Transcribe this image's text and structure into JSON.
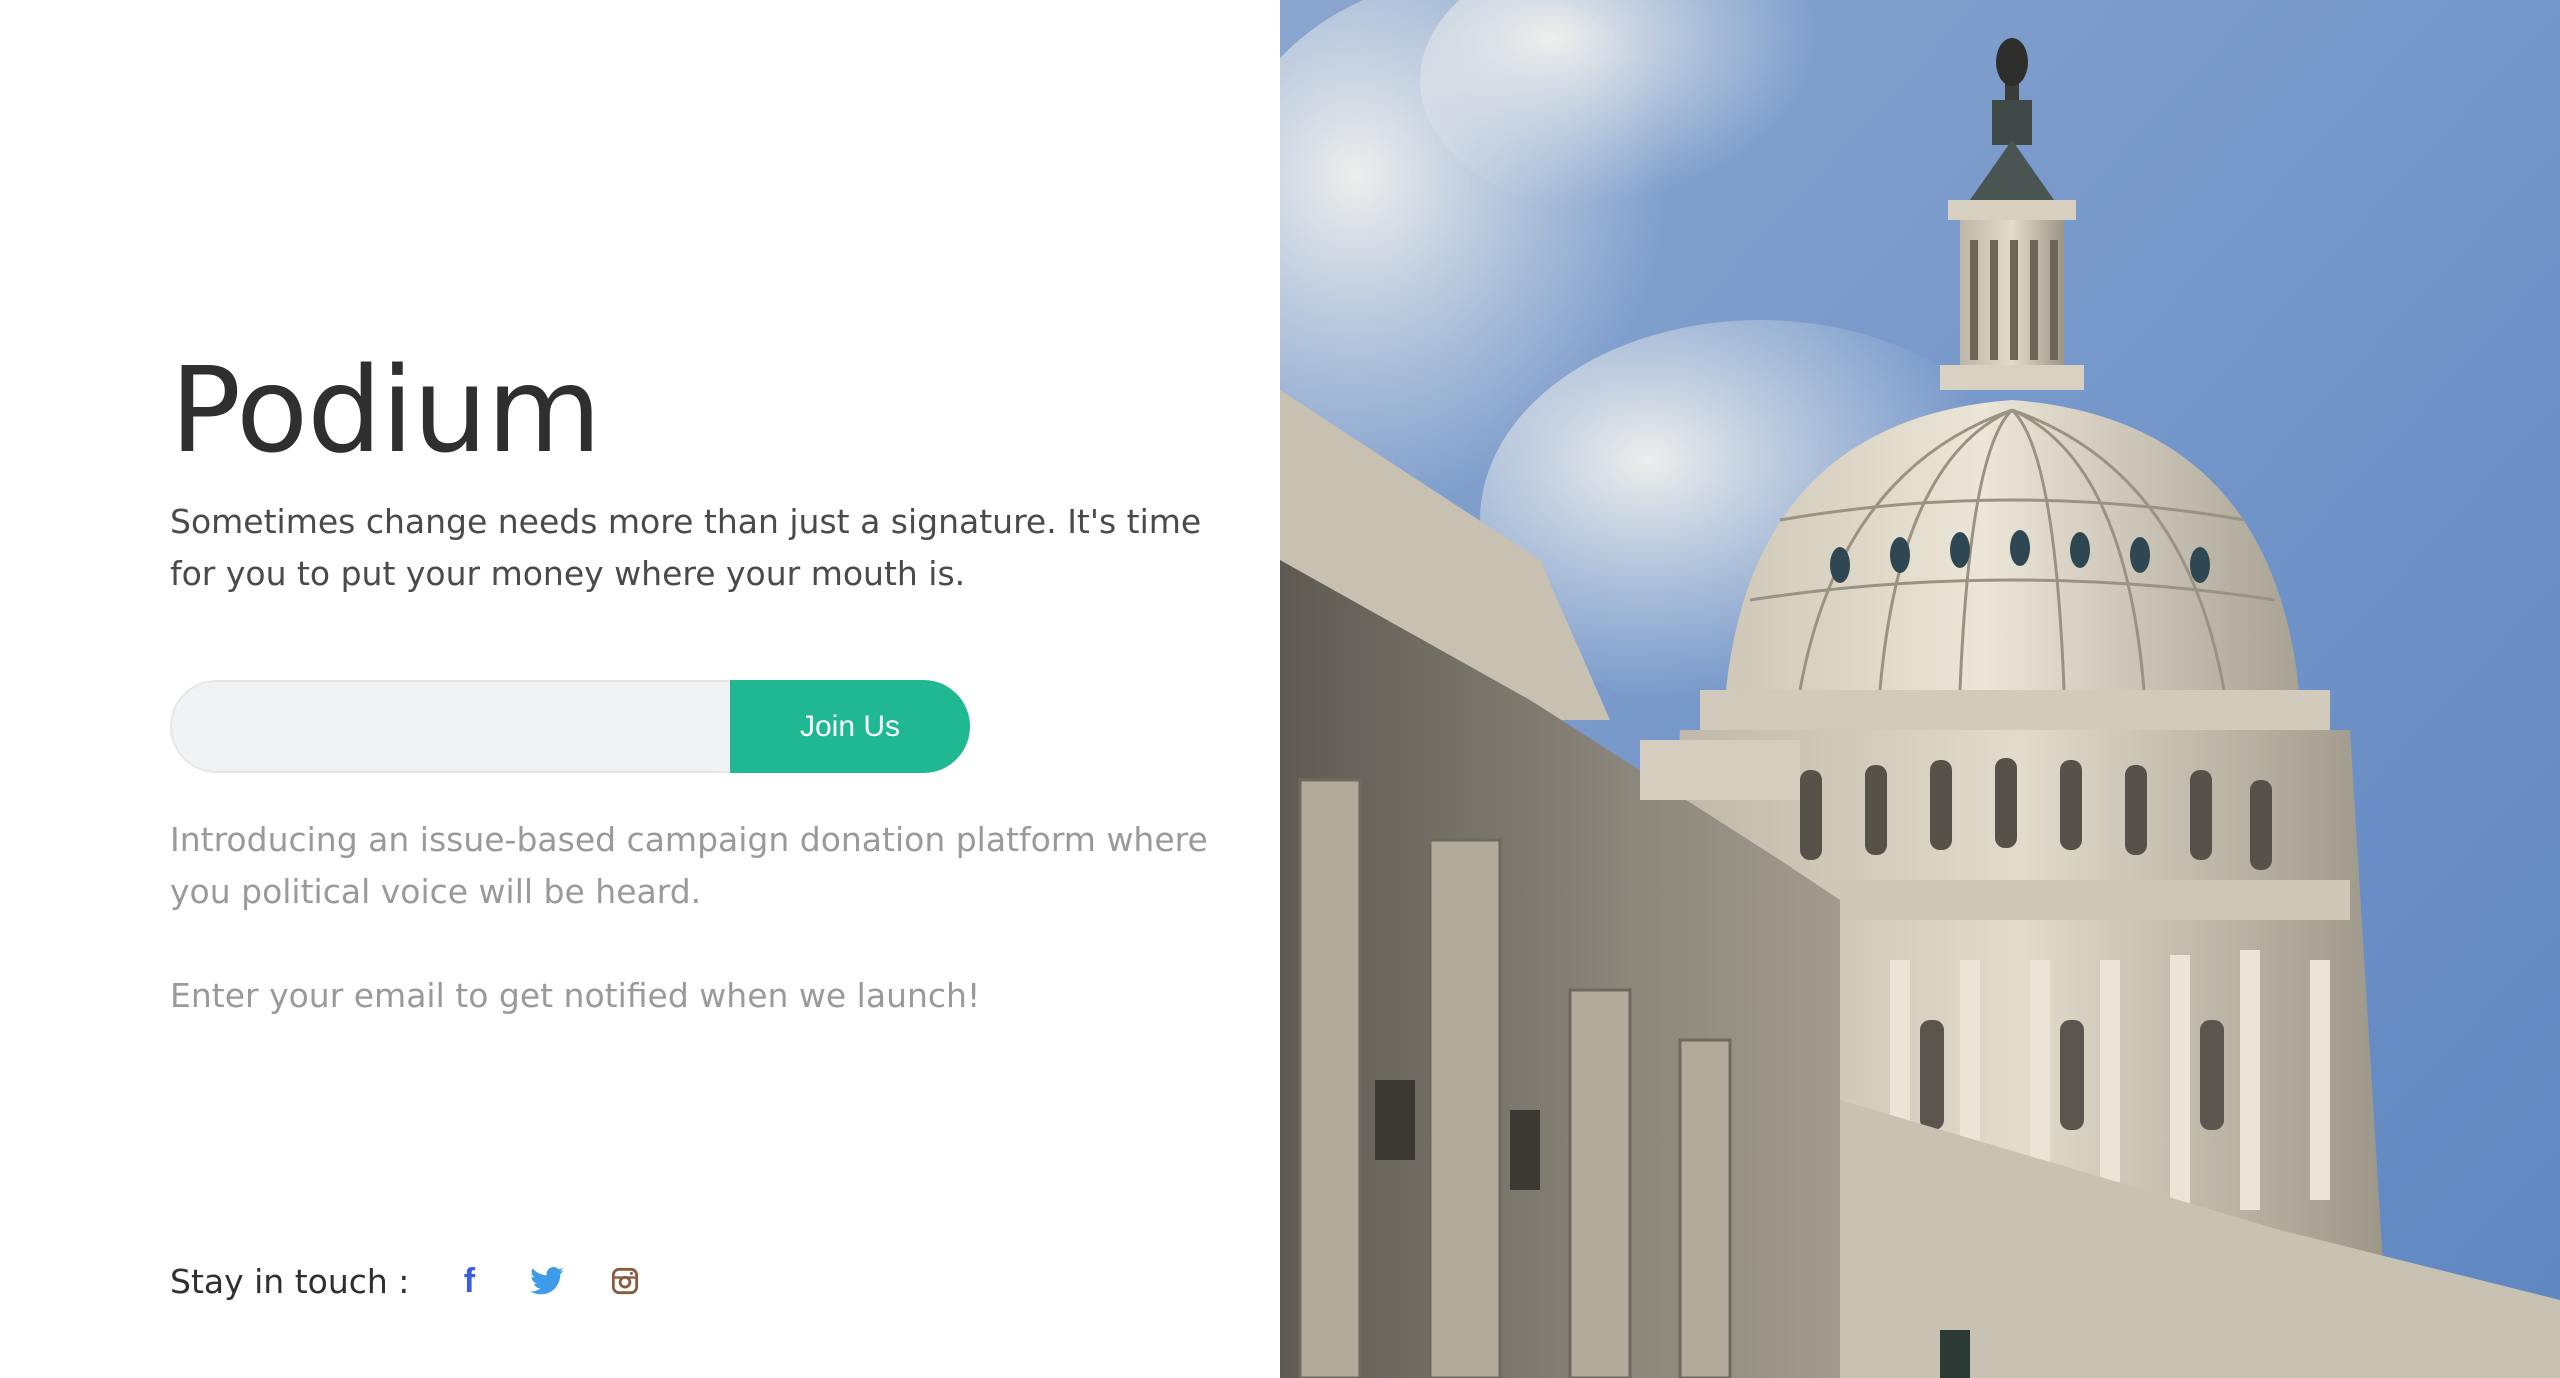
{
  "brand": {
    "title": "Podium"
  },
  "hero": {
    "tagline": "Sometimes change needs more than just a signature. It's time for you to put your money where your mouth is."
  },
  "signup": {
    "email_value": "",
    "email_placeholder": "",
    "button_label": "Join Us",
    "accent_color": "#1fb893"
  },
  "content": {
    "intro": "Introducing an issue-based campaign donation platform where you political voice will be heard.",
    "notify": "Enter your email to get notified when we launch!"
  },
  "social": {
    "label": "Stay in touch :",
    "icons": [
      "facebook-icon",
      "twitter-icon",
      "instagram-icon"
    ],
    "facebook_glyph": "f"
  },
  "photo": {
    "subject": "capitol-dome-photo"
  }
}
